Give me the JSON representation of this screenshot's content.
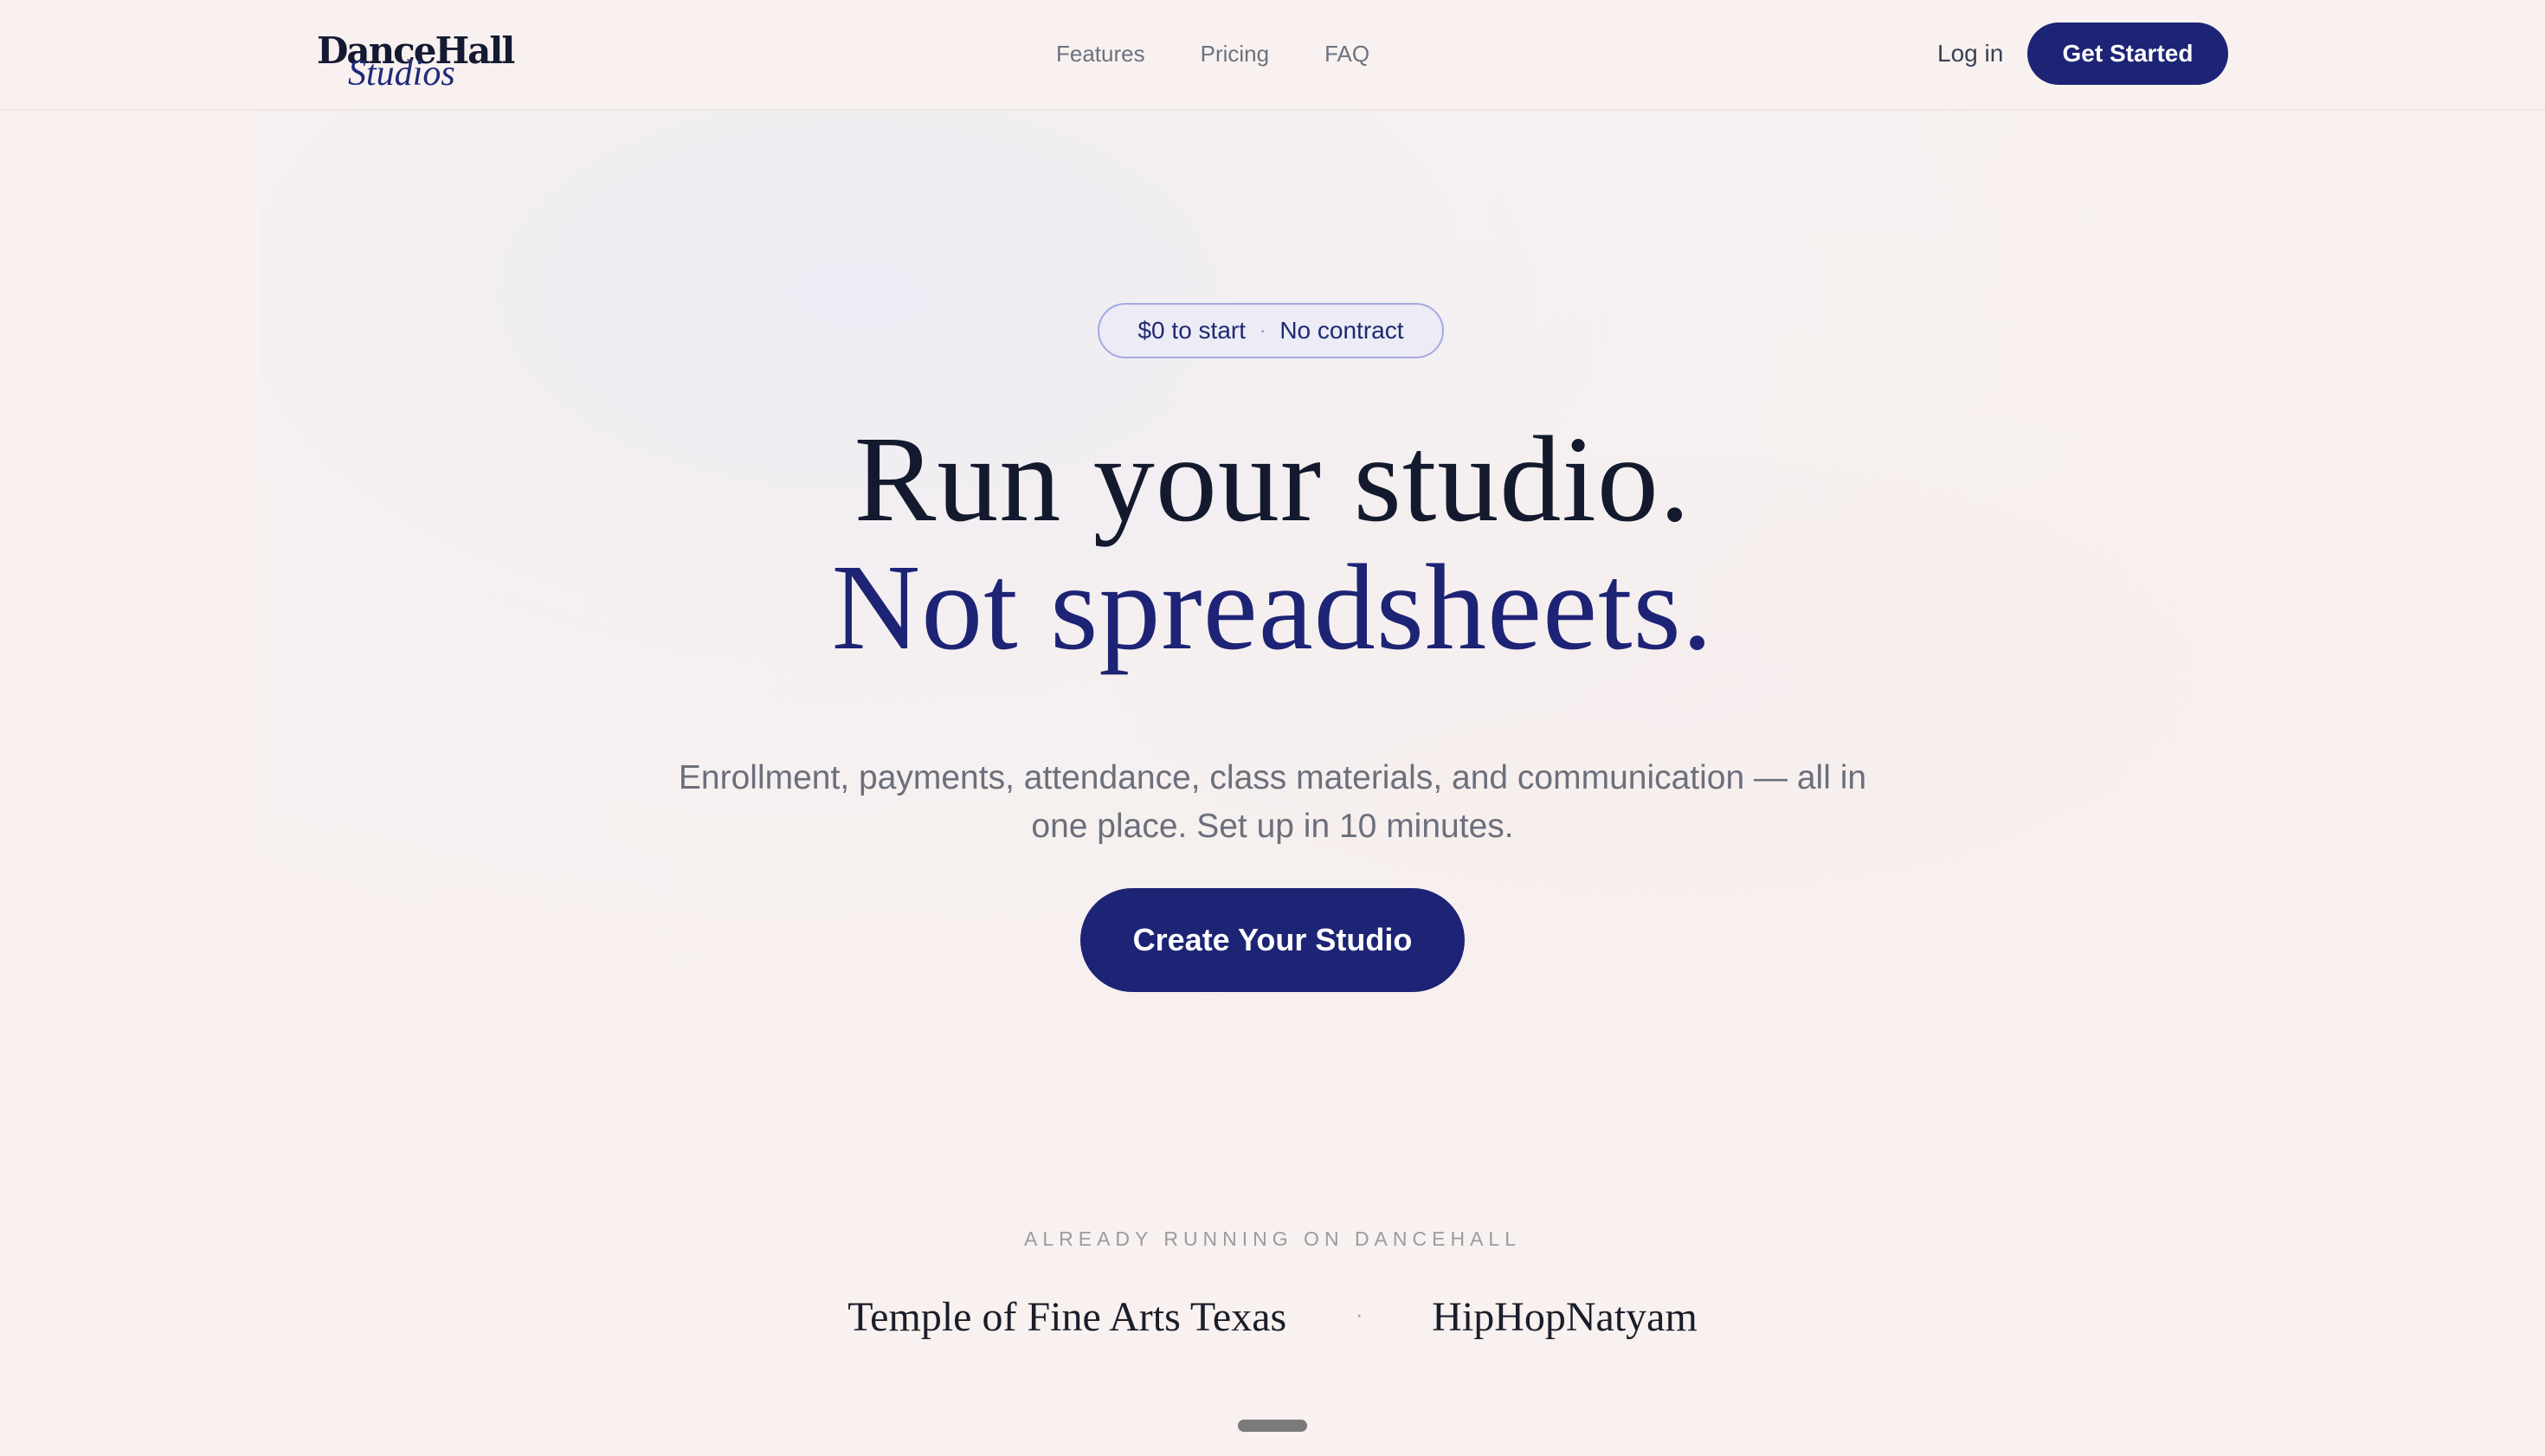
{
  "brand": {
    "name": "DanceHall",
    "script": "Studios"
  },
  "nav": {
    "links": [
      "Features",
      "Pricing",
      "FAQ"
    ],
    "login_label": "Log in",
    "cta_label": "Get Started"
  },
  "hero": {
    "pill_left": "$0 to start",
    "pill_sep": "·",
    "pill_right": "No contract",
    "headline_line1": "Run your studio.",
    "headline_line2": "Not spreadsheets.",
    "subtitle": "Enrollment, payments, attendance, class materials, and communication — all in one place. Set up in 10 minutes.",
    "cta_label": "Create Your Studio"
  },
  "social_proof": {
    "label": "ALREADY RUNNING ON DANCEHALL",
    "studios": [
      "Temple of Fine Arts Texas",
      "HipHopNatyam"
    ],
    "separator": "·"
  },
  "colors": {
    "background": "#f8f1ef",
    "accent": "#1d2475",
    "text_dark": "#141a2e",
    "text_muted": "#6b6f7c"
  }
}
